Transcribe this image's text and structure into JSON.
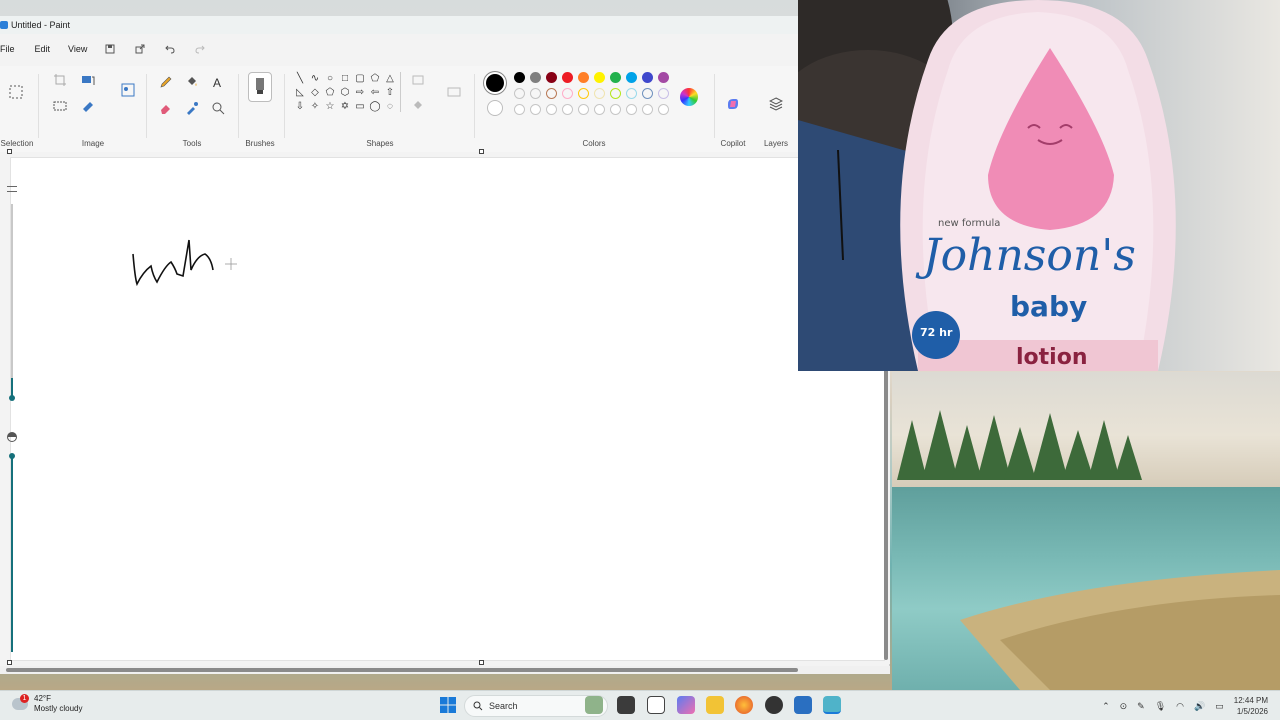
{
  "window": {
    "title": "Untitled - Paint"
  },
  "menu": {
    "file": "File",
    "edit": "Edit",
    "view": "View"
  },
  "ribbon": {
    "selection_label": "Selection",
    "image_label": "Image",
    "tools_label": "Tools",
    "brushes_label": "Brushes",
    "shapes_label": "Shapes",
    "colors_label": "Colors",
    "copilot_label": "Copilot",
    "layers_label": "Layers"
  },
  "colors": {
    "primary": "#000000",
    "row1": [
      "#000000",
      "#7f7f7f",
      "#880015",
      "#ed1c24",
      "#ff7f27",
      "#fff200",
      "#22b14c",
      "#00a2e8",
      "#3f48cc",
      "#a349a4"
    ],
    "row2": [
      "#ffffff",
      "#c3c3c3",
      "#b97a57",
      "#ffaec9",
      "#ffc90e",
      "#efe4b0",
      "#b5e61d",
      "#99d9ea",
      "#7092be",
      "#c8bfe7"
    ]
  },
  "canvas": {
    "drawn_text": "wh"
  },
  "webcam": {
    "product_top": "new formula",
    "brand": "Johnson's",
    "product": "baby",
    "variant": "lotion",
    "badge": "72 hr"
  },
  "taskbar": {
    "weather_temp": "42°F",
    "weather_desc": "Mostly cloudy",
    "weather_badge": "1",
    "search_placeholder": "Search",
    "time": "12:44 PM",
    "date": "1/5/2026"
  }
}
